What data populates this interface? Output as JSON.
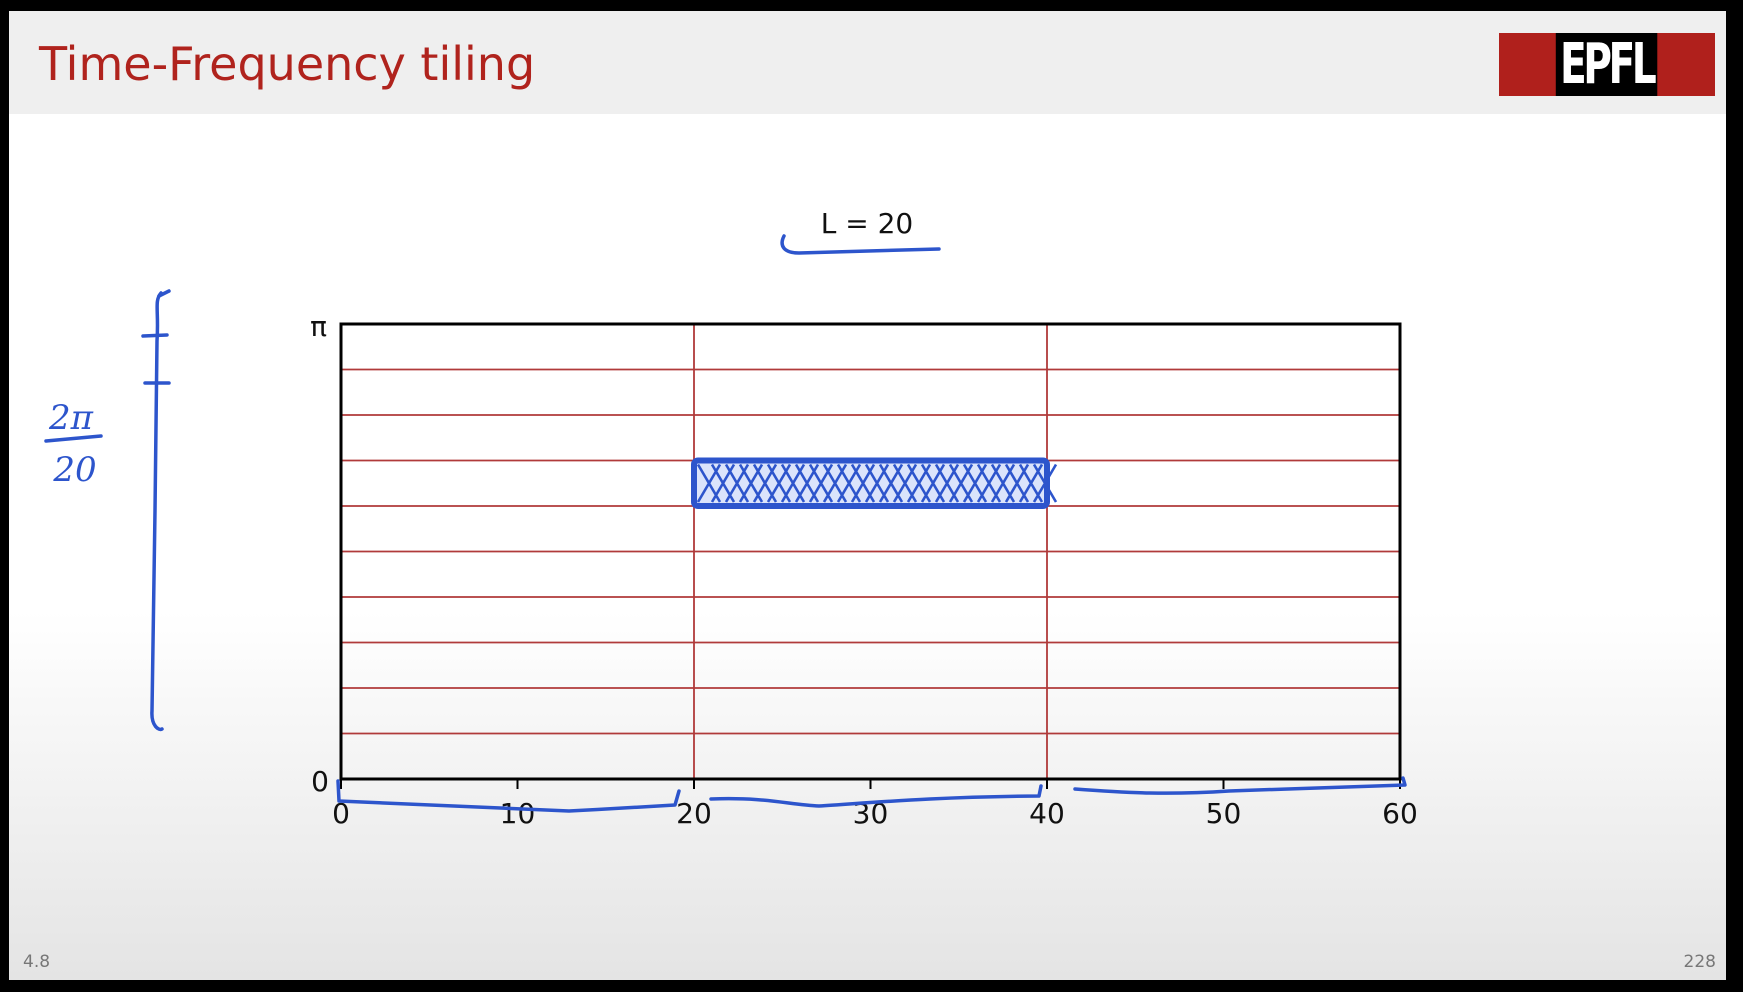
{
  "slide": {
    "title": "Time-Frequency tiling",
    "logo_text": "EPFL",
    "section_number": "4.8",
    "page_number": "228"
  },
  "colors": {
    "title": "#b0231d",
    "logo_bg": "#b0201c",
    "grid": "#b03a3a",
    "ink": "#2d55cc"
  },
  "chart_data": {
    "type": "heatmap",
    "title": "L = 20",
    "xlabel": "",
    "ylabel": "",
    "xlim": [
      0,
      60
    ],
    "xticks": [
      0,
      10,
      20,
      30,
      40,
      50,
      60
    ],
    "ylim_labels": [
      "0",
      "π"
    ],
    "time_tile_boundaries": [
      0,
      20,
      40,
      60
    ],
    "frequency_bands": 10,
    "highlighted_tile": {
      "time_start": 20,
      "time_end": 40,
      "band_index": 6
    }
  },
  "annotations": {
    "bandwidth_numerator": "2π",
    "bandwidth_denominator": "20"
  }
}
